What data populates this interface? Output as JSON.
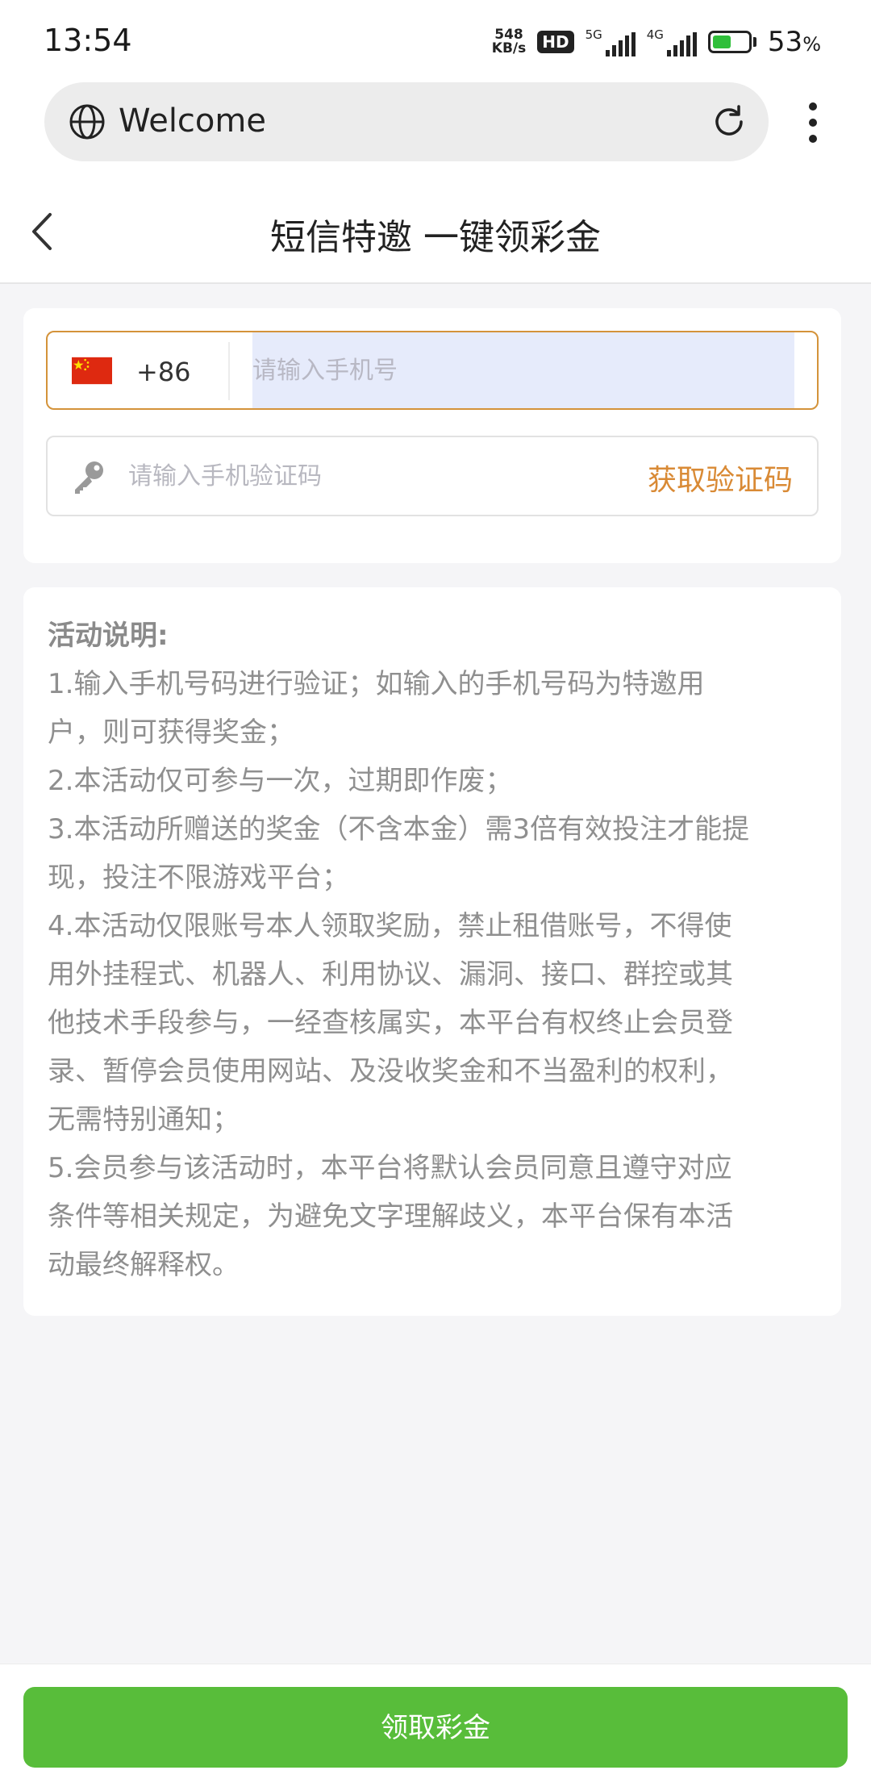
{
  "status_bar": {
    "time": "13:54",
    "speed_value": "548",
    "speed_unit": "KB/s",
    "hd_badge": "HD",
    "net1_label": "5G",
    "net2_label": "4G",
    "battery_percent": 53,
    "battery_text": "53",
    "battery_suffix": "%"
  },
  "browser": {
    "url_text": "Welcome",
    "globe_icon": "globe-icon",
    "reload_icon": "reload-icon",
    "menu_icon": "more-vertical-icon"
  },
  "header": {
    "back_icon": "chevron-left-icon",
    "title": "短信特邀 一键领彩金"
  },
  "form": {
    "country_flag": "china-flag-icon",
    "country_code": "+86",
    "phone_placeholder": "请输入手机号",
    "phone_value": "",
    "code_icon": "key-icon",
    "code_placeholder": "请输入手机验证码",
    "code_value": "",
    "get_code_label": "获取验证码"
  },
  "rules": {
    "title": "活动说明:",
    "lines": [
      "1.输入手机号码进行验证；如输入的手机号码为特邀用",
      "户，则可获得奖金；",
      "2.本活动仅可参与一次，过期即作废；",
      "3.本活动所赠送的奖金（不含本金）需3倍有效投注才能提",
      "现，投注不限游戏平台；",
      "4.本活动仅限账号本人领取奖励，禁止租借账号，不得使",
      "用外挂程式、机器人、利用协议、漏洞、接口、群控或其",
      "他技术手段参与，一经查核属实，本平台有权终止会员登",
      "录、暂停会员使用网站、及没收奖金和不当盈利的权利，",
      "无需特别通知；",
      "5.会员参与该活动时，本平台将默认会员同意且遵守对应",
      "条件等相关规定，为避免文字理解歧义，本平台保有本活",
      "动最终解释权。"
    ]
  },
  "footer": {
    "claim_label": "领取彩金"
  },
  "colors": {
    "accent_orange": "#d98a35",
    "button_green": "#58bd3a",
    "input_highlight": "#e6ebfb",
    "page_bg": "#f5f5f7"
  }
}
